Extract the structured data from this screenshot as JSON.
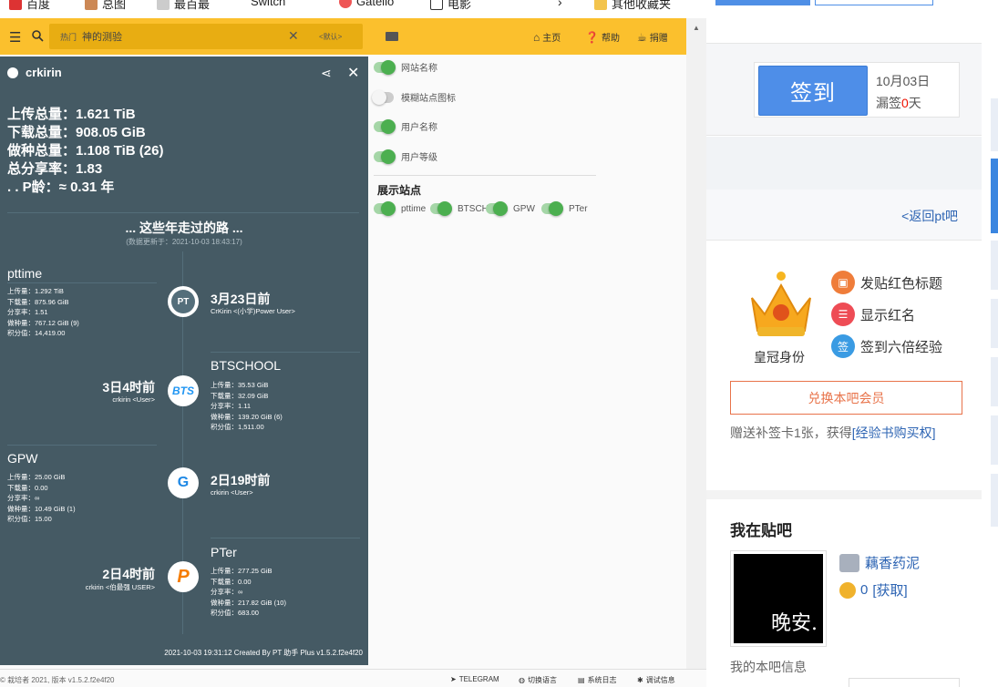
{
  "bookmarks": [
    "百度",
    "总图",
    "最百最",
    "Switch",
    "Gatello",
    "电影",
    "其他收藏夹"
  ],
  "toolbar": {
    "search_tag": "热门",
    "search_value": "神的测验",
    "search_default": "<默认>",
    "home": "主页",
    "help": "帮助",
    "donate": "捐赠"
  },
  "settings": {
    "options": [
      {
        "label": "网站名称",
        "on": true
      },
      {
        "label": "模糊站点图标",
        "on": false
      },
      {
        "label": "用户名称",
        "on": true
      },
      {
        "label": "用户等级",
        "on": true
      }
    ],
    "sites_title": "展示站点",
    "sites": [
      "pttime",
      "BTSCHOOL",
      "GPW",
      "PTer"
    ]
  },
  "card": {
    "username": "crkirin",
    "totals": [
      "上传总量：1.621 TiB",
      "下载总量：908.05 GiB",
      "做种总量：1.108 TiB (26)",
      "总分享率：1.83",
      ". .  P龄：≈ 0.31 年"
    ],
    "road_title": "... 这些年走过的路 ...",
    "road_sub": "(数据更新于：2021-10-03 18:43:17)",
    "timeline": [
      {
        "site": "pttime",
        "stats": [
          "上传量：1.292 TiB",
          "下载量：875.96 GiB",
          "分享率：1.51",
          "做种量：767.12 GiB (9)",
          "积分值：14,419.00"
        ],
        "when": "3月23日前",
        "who": "CrKirin  <(小学)Power User>",
        "icon": "PT"
      },
      {
        "site": "BTSCHOOL",
        "stats": [
          "上传量：35.53 GiB",
          "下载量：32.09 GiB",
          "分享率：1.11",
          "做种量：139.20 GiB (6)",
          "积分值：1,511.00"
        ],
        "when": "3日4时前",
        "who": "crkirin  <User>",
        "icon": "BTS"
      },
      {
        "site": "GPW",
        "stats": [
          "上传量：25.00 GiB",
          "下载量：0.00",
          "分享率：∞",
          "做种量：10.49 GiB (1)",
          "积分值：15.00"
        ],
        "when": "2日19时前",
        "who": "crkirin  <User>",
        "icon": "G"
      },
      {
        "site": "PTer",
        "stats": [
          "上传量：277.25 GiB",
          "下载量：0.00",
          "分享率：∞",
          "做种量：217.82 GiB (10)",
          "积分值：683.00"
        ],
        "when": "2日4时前",
        "who": "crkirin  <伯最强 USER>",
        "icon": "P"
      }
    ],
    "footer": "2021-10-03 19:31:12 Created By PT 助手 Plus v1.5.2.f2e4f20"
  },
  "status": {
    "left": "© 栽培者 2021, 版本 v1.5.2.f2e4f20",
    "telegram": "TELEGRAM",
    "language": "切换语言",
    "syslog": "系统日志",
    "debug": "调试信息"
  },
  "tieba": {
    "sign_button": "签到",
    "date": "10月03日",
    "missed_prefix": "漏签",
    "missed_count": "0",
    "missed_suffix": "天",
    "back_link": "<返回pt吧",
    "crown_label": "皇冠身份",
    "privileges": [
      "发贴红色标题",
      "显示红名",
      "签到六倍经验"
    ],
    "exchange_button": "兑换本吧会员",
    "gift_text": "赠送补签卡1张，获得",
    "gift_link": "[经验书购买权]",
    "my_bar_title": "我在贴吧",
    "avatar_text": "晚安.",
    "nickname": "藕香药泥",
    "coins": "0",
    "get_link": "[获取]",
    "my_info": "我的本吧信息"
  },
  "colors": {
    "toolbar": "#fbc02d",
    "card": "#455a64",
    "switch_on": "#4caf50",
    "sign_button": "#4e8ee8",
    "link": "#2d64b3",
    "accent_orange": "#e8734a"
  }
}
